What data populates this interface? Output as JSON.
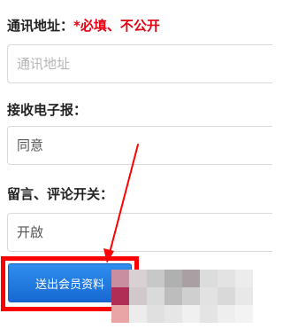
{
  "form": {
    "address": {
      "label": "通讯地址：",
      "required_note": "*必填、不公开",
      "placeholder": "通讯地址"
    },
    "newsletter": {
      "label": "接收电子报：",
      "value": "同意"
    },
    "comments": {
      "label": "留言、评论开关：",
      "value": "开啟"
    },
    "submit_label": "送出会员资料"
  },
  "colors": {
    "required": "#e60012",
    "annotation": "#ff0000",
    "button": "#1e78e0"
  },
  "mosaic": [
    [
      "#c98ea0",
      "#d8d0d3",
      "#c8c8c8",
      "#b0b0b0",
      "#a9a0a3",
      "#dcdcdc",
      "#e3e3e3",
      "#ececec"
    ],
    [
      "#b02d55",
      "#d0c8cb",
      "#dadada",
      "#bdbdbd",
      "#cfcfcf",
      "#e2e2e2",
      "#d9d9d9",
      "#e8e8e8"
    ],
    [
      "#e9a5a5",
      "#ececec",
      "#e0e0e0",
      "#e6e6e6",
      "#f0f0f0",
      "#e4e4e4",
      "#eeeeee",
      "#f3f3f3"
    ]
  ]
}
